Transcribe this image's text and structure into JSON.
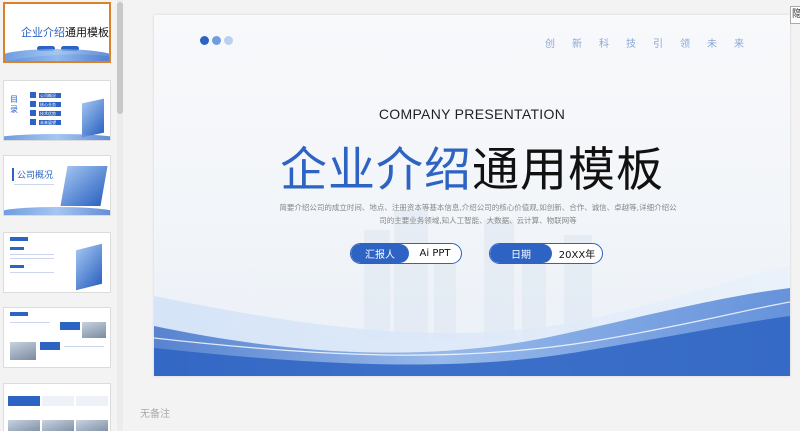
{
  "slide": {
    "company": "COMPANY PRESENTATION",
    "title_blue": "企业介绍",
    "title_dark": "通用模板",
    "description": "简要介绍公司的成立时间、地点、注册资本等基本信息,介绍公司的核心价值观,如创新、合作、诚信、卓越等,详细介绍公司的主要业务领域,知人工智能、大数据、云计算、物联网等",
    "tagline": [
      "创",
      "新",
      "科",
      "技",
      "引",
      "领",
      "未",
      "来"
    ],
    "reporter_label": "汇报人",
    "reporter_value": "Ai PPT",
    "date_label": "日期",
    "date_value": "20XX年"
  },
  "thumbnails": {
    "t1_title_blue": "企业介绍",
    "t1_title_dark": "通用模板",
    "toc_label": "目录",
    "toc_items": [
      "公司概况",
      "核心业务",
      "技术优势",
      "未来展望"
    ],
    "t3_title": "公司概况"
  },
  "notes_placeholder": "无备注",
  "edge_button": "隐",
  "colors": {
    "accent": "#2d63c2",
    "active_thumb_border": "#d9822b"
  }
}
